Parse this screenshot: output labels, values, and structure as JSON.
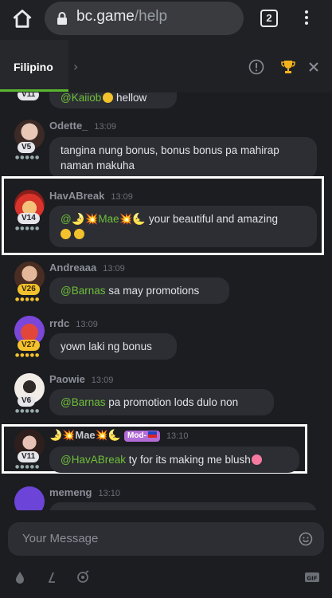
{
  "browser": {
    "url_host": "bc.game",
    "url_path": "/help",
    "tab_count": "2"
  },
  "chat_header": {
    "language": "Filipino"
  },
  "messages": [
    {
      "mention": "@Kaiiob",
      "text": " hellow"
    },
    {
      "name": "Odette_",
      "time": "13:09",
      "level": "V5",
      "text": "tangina nung bonus, bonus bonus pa mahirap naman makuha"
    },
    {
      "name": "HavABreak",
      "time": "13:09",
      "level": "V14",
      "mention": "@🌛💥Mae💥🌜",
      "text": " your beautiful and amazing"
    },
    {
      "name": "Andreaaa",
      "time": "13:09",
      "level": "V26",
      "mention": "@Barnas",
      "text": " sa may promotions"
    },
    {
      "name": "rrdc",
      "time": "13:09",
      "level": "V27",
      "text": "yown laki ng bonus"
    },
    {
      "name": "Paowie",
      "time": "13:09",
      "level": "V6",
      "mention": "@Barnas",
      "text": " pa promotion lods dulo non"
    },
    {
      "name": "🌛💥Mae💥🌜",
      "badge": "Mod-",
      "time": "13:10",
      "level": "V11",
      "mention": "@HavABreak",
      "text": " ty for its making me blush"
    },
    {
      "name": "memeng",
      "time": "13:10"
    }
  ],
  "composer": {
    "placeholder": "Your Message"
  },
  "colors": {
    "background": "#1b1d21",
    "bubble": "#2c2e33",
    "mention": "#6fbf3a",
    "accent": "#5ab52e"
  }
}
